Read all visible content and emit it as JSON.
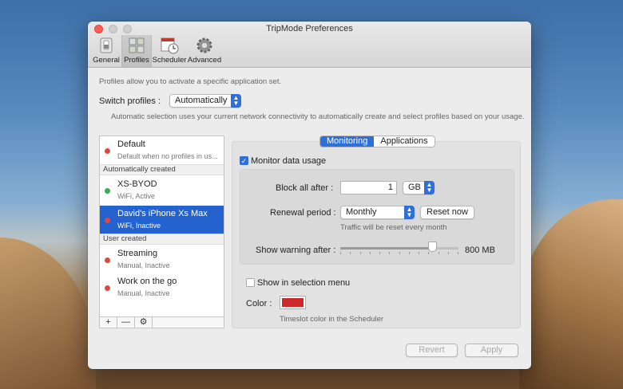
{
  "window": {
    "title": "TripMode Preferences"
  },
  "toolbar": {
    "tabs": [
      {
        "label": "General",
        "icon": "switch-icon"
      },
      {
        "label": "Profiles",
        "icon": "profiles-icon"
      },
      {
        "label": "Scheduler",
        "icon": "calendar-clock-icon"
      },
      {
        "label": "Advanced",
        "icon": "gear-icon"
      }
    ],
    "active_tab": "Profiles"
  },
  "profiles_intro": "Profiles allow you to activate a specific application set.",
  "switch": {
    "label": "Switch profiles :",
    "value": "Automatically",
    "hint": "Automatic selection uses your current network connectivity to automatically create and select profiles based on your usage."
  },
  "list": {
    "default": {
      "name": "Default",
      "sub": "Default when no profiles in us...",
      "status_color": "#e2463f"
    },
    "section_auto": "Automatically created",
    "auto": [
      {
        "name": "XS-BYOD",
        "sub": "WiFi, Active",
        "status_color": "#35b14b"
      },
      {
        "name": "David's iPhone Xs Max",
        "sub": "WiFi, Inactive",
        "status_color": "#e2463f"
      }
    ],
    "section_user": "User created",
    "user": [
      {
        "name": "Streaming",
        "sub": "Manual, Inactive",
        "status_color": "#e2463f"
      },
      {
        "name": "Work on the go",
        "sub": "Manual, Inactive",
        "status_color": "#e2463f"
      }
    ],
    "buttons": {
      "add": "+",
      "remove": "—"
    }
  },
  "detail": {
    "tabs": {
      "monitoring": "Monitoring",
      "applications": "Applications"
    },
    "monitor": {
      "label": "Monitor data usage",
      "checked": true
    },
    "block": {
      "label": "Block all after :",
      "value": "1",
      "unit": "GB"
    },
    "renewal": {
      "label": "Renewal period :",
      "value": "Monthly",
      "reset_label": "Reset now",
      "hint": "Traffic will be reset every month"
    },
    "warning": {
      "label": "Show warning after :",
      "value": "800 MB",
      "slider_fraction": 0.78
    },
    "selection_menu": {
      "label": "Show in selection menu",
      "checked": false
    },
    "color": {
      "label": "Color :",
      "value": "#cc2a2a",
      "hint": "Timeslot color in the Scheduler"
    }
  },
  "footer": {
    "revert": "Revert",
    "apply": "Apply"
  },
  "accent": "#2f6fd8"
}
